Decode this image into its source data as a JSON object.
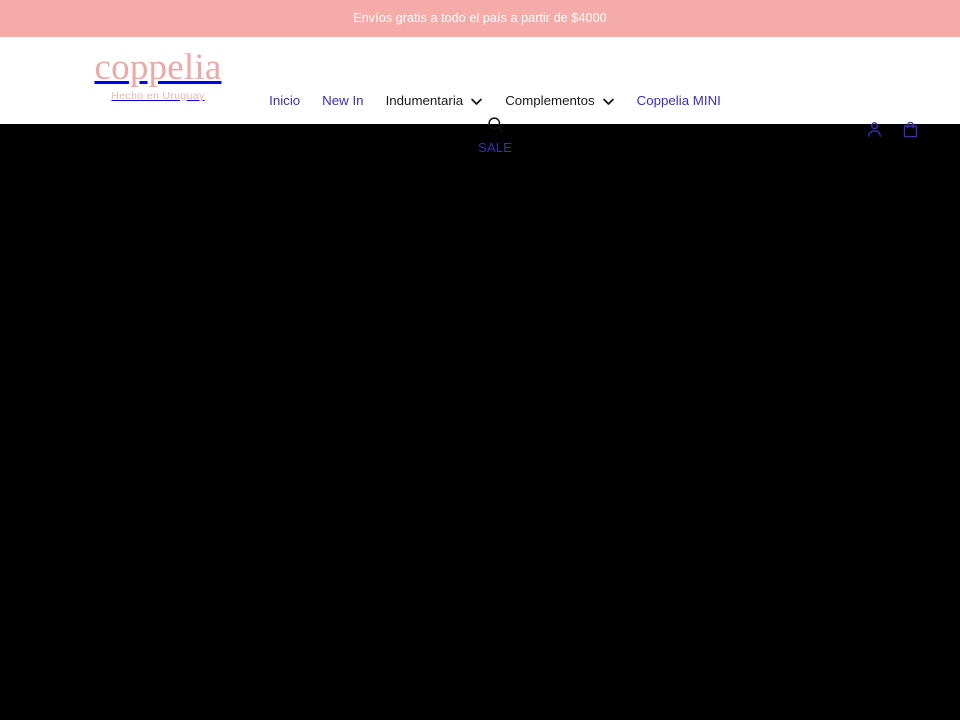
{
  "announcement": {
    "text": "Envíos gratis a todo el país a partir de $4000",
    "background_color": "#f5aba8",
    "text_color": "#ffffff"
  },
  "header": {
    "logo": {
      "wordmark": "coppelia",
      "tagline": "Hecho en Uruguay",
      "color": "#eda9a6"
    },
    "nav": {
      "items": [
        {
          "label": "Inicio",
          "has_dropdown": false,
          "color": "#3c2fb0",
          "state": "visited"
        },
        {
          "label": "New In",
          "has_dropdown": false,
          "color": "#3c2fb0",
          "state": "visited"
        },
        {
          "label": "Indumentaria",
          "has_dropdown": true,
          "color": "#1a1a1a",
          "state": "default"
        },
        {
          "label": "Complementos",
          "has_dropdown": true,
          "color": "#1a1a1a",
          "state": "default"
        },
        {
          "label": "Coppelia MINI",
          "has_dropdown": false,
          "color": "#3c2fb0",
          "state": "visited"
        }
      ],
      "secondary_items": [
        {
          "label": "SALE",
          "has_dropdown": false,
          "color": "#3c2fb0",
          "state": "visited"
        }
      ],
      "search_icon": "search-icon",
      "dropdown_icon": "chevron-down-icon"
    },
    "actions": [
      {
        "icon": "account-icon",
        "label": "Cuenta"
      },
      {
        "icon": "shopping-bag-icon",
        "label": "Carrito"
      }
    ],
    "background_color": "#ffffff"
  },
  "main": {
    "background_color": "#000000",
    "content": ""
  }
}
